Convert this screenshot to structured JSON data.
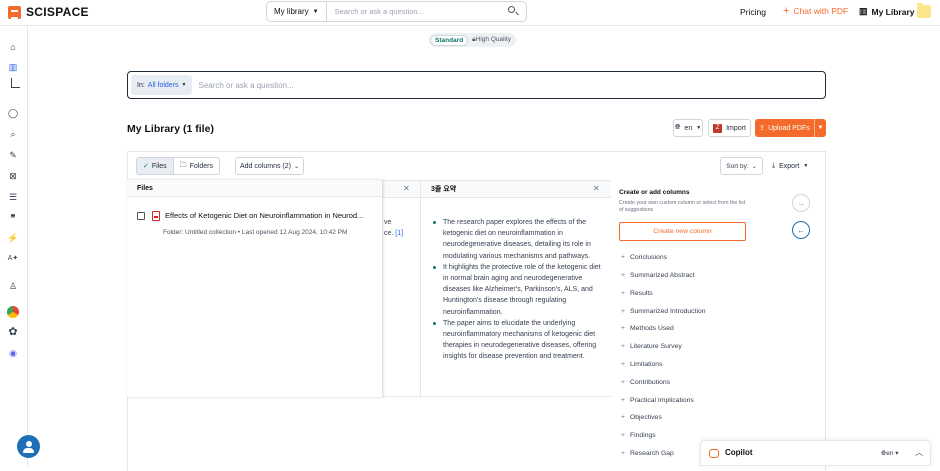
{
  "header": {
    "logo": "SCISPACE",
    "library_dropdown": "My library",
    "search_placeholder": "Search or ask a question...",
    "pricing": "Pricing",
    "chat_with_pdf": "Chat with PDF",
    "my_library": "My Library"
  },
  "mode": {
    "standard": "Standard",
    "high_quality": "High Quality"
  },
  "search": {
    "scope_prefix": "In:",
    "scope_value": "All folders",
    "placeholder": "Search or ask a question..."
  },
  "library": {
    "title": "My Library (1 file)",
    "language": "en",
    "import_label": "Import",
    "upload_label": "Upload PDFs"
  },
  "toolbar": {
    "files_tab": "Files",
    "folders_tab": "Folders",
    "add_columns": "Add columns (2)",
    "sort_by": "Sort by:",
    "export": "Export"
  },
  "table": {
    "files_header": "Files",
    "summary_header": "3줄 요약",
    "paper_title": "Effects of Ketogenic Diet on Neuroinflammation in Neurod...",
    "paper_meta": "Folder: Untitled collection •  Last opened 12 Aug 2024, 10:42 PM",
    "peek_line1": "ve",
    "peek_line2": "ce.",
    "peek_cite": "[1]",
    "summary_points": [
      "The research paper explores the effects of the ketogenic diet on neuroinflammation in neurodegenerative diseases, detailing its role in modulating various mechanisms and pathways.",
      "It highlights the protective role of the ketogenic diet in normal brain aging and neurodegenerative diseases like Alzheimer's, Parkinson's, ALS, and Huntington's disease through regulating neuroinflammation.",
      "The paper aims to elucidate the underlying neuroinflammatory mechanisms of ketogenic diet therapies in neurodegenerative diseases, offering insights for disease prevention and treatment."
    ]
  },
  "column_panel": {
    "title": "Create or add columns",
    "subtitle": "Create your own custom column or select from the list of suggestions",
    "create_button": "Create new column",
    "items": [
      "Conclusions",
      "Summarized Abstract",
      "Results",
      "Summarized Introduction",
      "Methods Used",
      "Literature Survey",
      "Limitations",
      "Contributions",
      "Practical Implications",
      "Objectives",
      "Findings",
      "Research Gap"
    ]
  },
  "copilot": {
    "label": "Copilot",
    "language": "en"
  },
  "colors": {
    "accent": "#f26b2a",
    "teal": "#0f766e",
    "link": "#2563eb"
  }
}
